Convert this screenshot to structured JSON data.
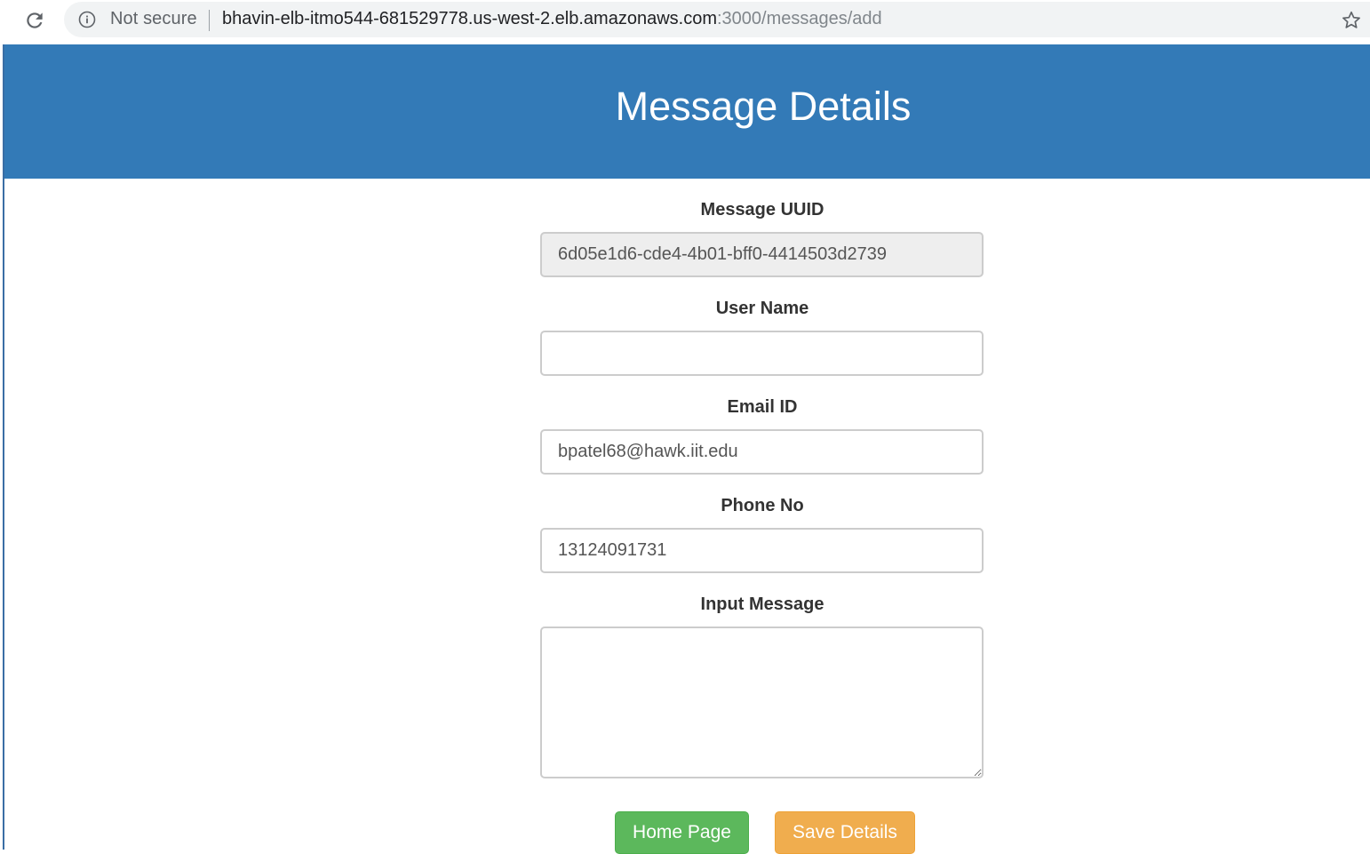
{
  "browser": {
    "reload_icon": "reload-icon",
    "info_icon": "info-icon",
    "security_label": "Not secure",
    "url_host": "bhavin-elb-itmo544-681529778.us-west-2.elb.amazonaws.com",
    "url_path": ":3000/messages/add",
    "star_icon": "star-icon"
  },
  "header": {
    "title": "Message Details",
    "color": "#337ab7"
  },
  "form": {
    "uuid_label": "Message UUID",
    "uuid_value": "6d05e1d6-cde4-4b01-bff0-4414503d2739",
    "username_label": "User Name",
    "username_value": "",
    "email_label": "Email ID",
    "email_value": "bpatel68@hawk.iit.edu",
    "phone_label": "Phone No",
    "phone_value": "13124091731",
    "message_label": "Input Message",
    "message_value": ""
  },
  "buttons": {
    "home_label": "Home Page",
    "home_color": "#5cb85c",
    "save_label": "Save Details",
    "save_color": "#f0ad4e"
  }
}
